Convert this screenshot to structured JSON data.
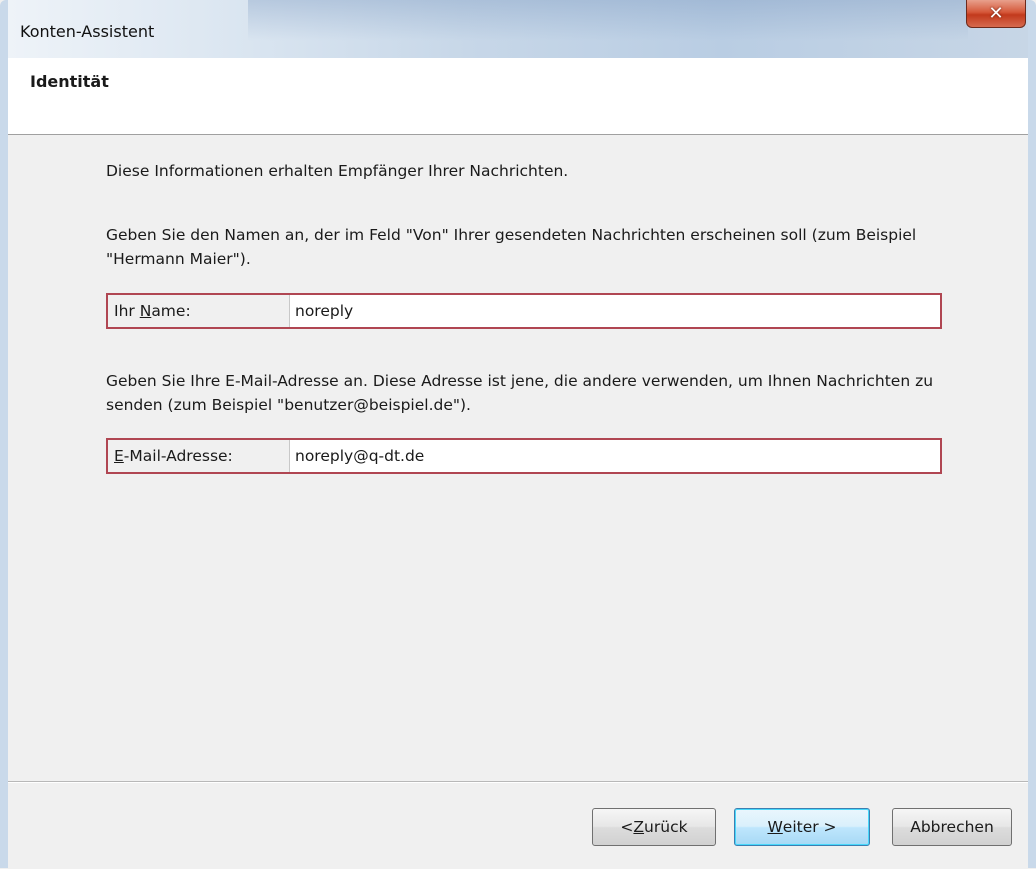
{
  "window": {
    "title": "Konten-Assistent",
    "close_glyph": "✕"
  },
  "header": {
    "title": "Identität"
  },
  "content": {
    "intro": "Diese Informationen erhalten Empfänger Ihrer Nachrichten.",
    "name_hint": "Geben Sie den Namen an, der im Feld \"Von\" Ihrer gesendeten Nachrichten erscheinen soll (zum Beispiel \"Hermann Maier\").",
    "name_field": {
      "label_pre": "Ihr ",
      "label_accel": "N",
      "label_post": "ame:",
      "value": "noreply"
    },
    "email_hint": "Geben Sie Ihre E-Mail-Adresse an. Diese Adresse ist jene, die andere verwenden, um Ihnen Nachrichten zu senden (zum Beispiel \"benutzer@beispiel.de\").",
    "email_field": {
      "label_accel": "E",
      "label_post": "-Mail-Adresse:",
      "value": "noreply@q-dt.de"
    }
  },
  "footer": {
    "back": {
      "pre": "< ",
      "accel": "Z",
      "post": "urück"
    },
    "next": {
      "accel": "W",
      "post": "eiter >"
    },
    "cancel": "Abbrechen"
  },
  "colors": {
    "highlight_border": "#b04652",
    "default_button": "#3c7fb1"
  }
}
